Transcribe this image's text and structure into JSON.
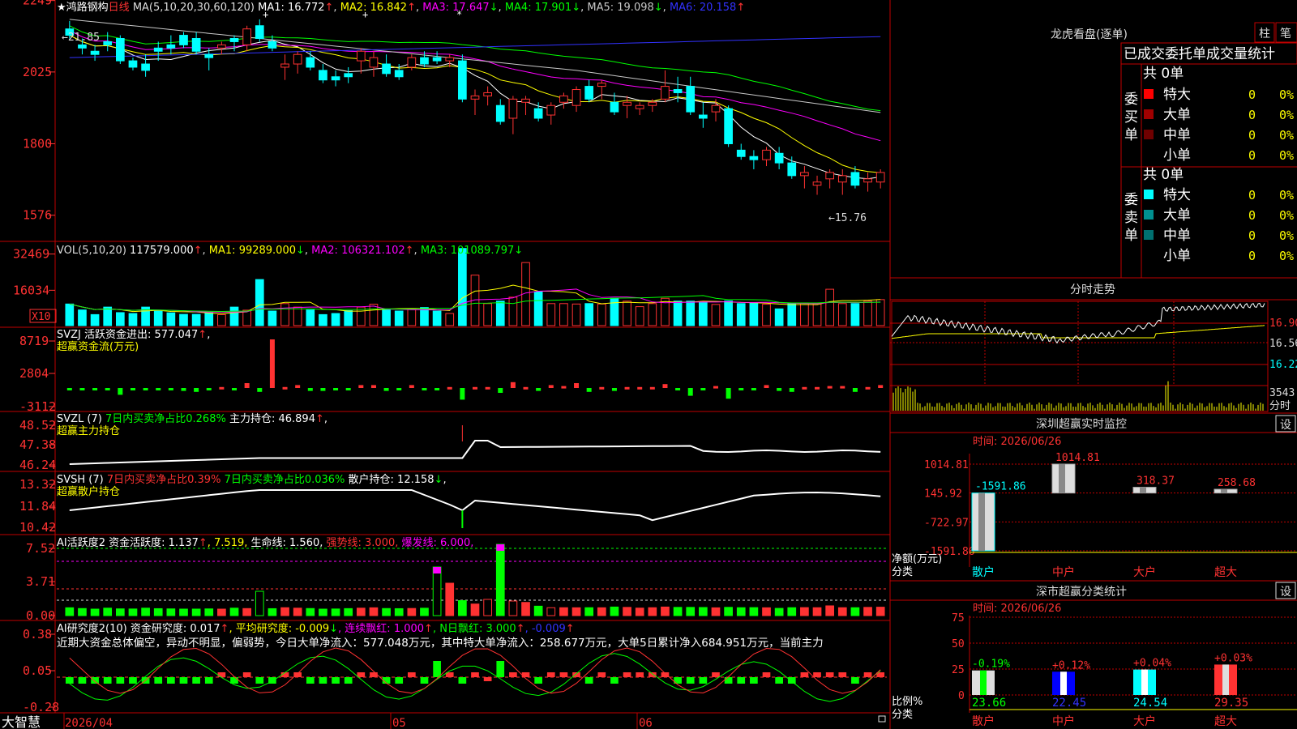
{
  "app_name": "大智慧",
  "colors": {
    "up": "#ff3232",
    "down": "#00ffff",
    "ma1": "#ffffff",
    "ma2": "#ffff00",
    "ma3": "#ff00ff",
    "ma4": "#00ff00",
    "ma5": "#c8c8c8",
    "ma6": "#3232ff",
    "panel_border": "#c00000",
    "axis_text": "#ff3232",
    "green": "#00ff00"
  },
  "kline": {
    "title_star": "★",
    "stock_name": "鸿路钢构",
    "period": "日线",
    "ma_params": "MA(5,10,20,30,60,120)",
    "ma_values": [
      {
        "label": "MA1: 16.772",
        "arrow": "↑",
        "arrow_color": "#ff3232",
        "color": "#ffffff"
      },
      {
        "label": "MA2: 16.842",
        "arrow": "↑",
        "arrow_color": "#ff3232",
        "color": "#ffff00"
      },
      {
        "label": "MA3: 17.647",
        "arrow": "↓",
        "arrow_color": "#00ff00",
        "color": "#ff00ff"
      },
      {
        "label": "MA4: 17.901",
        "arrow": "↓",
        "arrow_color": "#00ff00",
        "color": "#00ff00"
      },
      {
        "label": "MA5: 19.098",
        "arrow": "↓",
        "arrow_color": "#00ff00",
        "color": "#c8c8c8"
      },
      {
        "label": "MA6: 20.158",
        "arrow": "↑",
        "arrow_color": "#ff3232",
        "color": "#3232ff"
      }
    ],
    "y_ticks": [
      "2249",
      "2025",
      "1800",
      "1576"
    ],
    "high_label": "←21.85",
    "low_label": "←15.76"
  },
  "volume": {
    "params": "VOL(5,10,20)",
    "value": "117579.000",
    "value_arrow": "↑",
    "ma": [
      {
        "label": "MA1: 99289.000",
        "arrow": "↓",
        "color": "#ffff00",
        "arrow_color": "#00ff00"
      },
      {
        "label": "MA2: 106321.102",
        "arrow": "↑",
        "color": "#ff00ff",
        "arrow_color": "#ff3232"
      },
      {
        "label": "MA3: 101089.797",
        "arrow": "↓",
        "color": "#00ff00",
        "arrow_color": "#00ff00"
      }
    ],
    "y_ticks": [
      "32469",
      "16034"
    ],
    "unit": "X10"
  },
  "svzj": {
    "line1_prefix": "SVZJ  活跃资金进出: 577.047",
    "line1_arrow": "↑",
    "line1_tail": ",",
    "line2": "超赢资金流(万元)",
    "y_ticks": [
      "8719",
      "2804",
      "-3112"
    ]
  },
  "svzl": {
    "prefix": "SVZL (7)",
    "part1": "7日内买卖净占比0.268%",
    "part2": "主力持仓: 46.894",
    "arrow": "↑",
    "tail": ",",
    "line2": "超赢主力持仓",
    "y_ticks": [
      "48.52",
      "47.38",
      "46.24"
    ]
  },
  "svsh": {
    "prefix": "SVSH (7)",
    "part1": "7日内买卖净占比0.39%",
    "part2": "7日内买卖净占比0.036%",
    "part3": "散户持仓: 12.158",
    "arrow": "↓",
    "tail": ",",
    "line2": "超赢散户持仓",
    "y_ticks": [
      "13.32",
      "11.84",
      "10.42"
    ]
  },
  "ai_active": {
    "title": "AI活跃度2 资金活跃度: 1.137",
    "arrow1": "↑",
    "part2": ", 7.519,",
    "part3": "生命线: 1.560,",
    "part4": "强势线: 3.000,",
    "part5": "爆发线: 6.000,",
    "y_ticks": [
      "7.52",
      "3.71",
      "0.00"
    ]
  },
  "ai_research": {
    "title": "AI研究度2(10) 资金研究度: 0.017",
    "arrow1": "↑",
    "part2": ", 平均研究度: -0.009",
    "arrow2": "↓",
    "part3": ", 连续飘红: 1.000",
    "arrow3": "↑",
    "part4": ", N日飘红: 3.000",
    "arrow4": "↑",
    "part5": ", -0.009",
    "arrow5": "↑",
    "comment": "近期大资金总体偏空，异动不明显，偏弱势，今日大单净流入：577.048万元，其中特大单净流入：258.677万元，大单5日累计净入684.951万元，当前主力",
    "y_ticks": [
      "0.38",
      "0.05",
      "-0.28"
    ]
  },
  "x_axis": {
    "labels": [
      "2026/04",
      "05",
      "06"
    ]
  },
  "longhu": {
    "title": "龙虎看盘(逐单)",
    "btn_zhu": "柱",
    "btn_bi": "笔",
    "tabs_header": "已成交委托单成交量统计",
    "buy_label": "委买单",
    "sell_label": "委卖单",
    "buy_total": "共 0单",
    "sell_total": "共 0单",
    "buy_rows": [
      {
        "name": "特大",
        "vol": "0",
        "pct": "0%",
        "color": "#ff0000"
      },
      {
        "name": "大单",
        "vol": "0",
        "pct": "0%",
        "color": "#a00000"
      },
      {
        "name": "中单",
        "vol": "0",
        "pct": "0%",
        "color": "#700000"
      },
      {
        "name": "小单",
        "vol": "0",
        "pct": "0%",
        "color": ""
      }
    ],
    "sell_rows": [
      {
        "name": "特大",
        "vol": "0",
        "pct": "0%",
        "color": "#00ffff"
      },
      {
        "name": "大单",
        "vol": "0",
        "pct": "0%",
        "color": "#009090"
      },
      {
        "name": "中单",
        "vol": "0",
        "pct": "0%",
        "color": "#007070"
      },
      {
        "name": "小单",
        "vol": "0",
        "pct": "0%",
        "color": ""
      }
    ]
  },
  "intraday": {
    "title": "分时走势",
    "y_ticks": [
      "16.90",
      "16.56",
      "16.22"
    ],
    "vol_tick": "3543",
    "vol_label": "分时"
  },
  "sz_monitor": {
    "title": "深圳超赢实时监控",
    "settings": "设",
    "time_label": "时间: 2026/06/26",
    "y_ticks": [
      "1014.81",
      "145.92",
      "-722.97",
      "-1591.86"
    ],
    "axis_label1": "净额(万元)",
    "axis_label2": "分类",
    "categories": [
      "散户",
      "中户",
      "大户",
      "超大"
    ],
    "values": [
      -1591.86,
      1014.81,
      318.37,
      258.68
    ],
    "value_labels": [
      "-1591.86",
      "1014.81",
      "318.37",
      "258.68"
    ]
  },
  "sz_class": {
    "title": "深市超赢分类统计",
    "settings": "设",
    "time_label": "时间: 2026/06/26",
    "y_ticks": [
      "75",
      "50",
      "25",
      "0"
    ],
    "axis_label1": "比例%",
    "axis_label2": "分类",
    "categories": [
      "散户",
      "中户",
      "大户",
      "超大"
    ],
    "values": [
      23.66,
      22.45,
      24.54,
      29.35
    ],
    "value_labels": [
      "23.66",
      "22.45",
      "24.54",
      "29.35"
    ],
    "change_labels": [
      "-0.19%",
      "+0.12%",
      "+0.04%",
      "+0.03%"
    ]
  },
  "chart_data": {
    "type": "candlestick",
    "title": "鸿路钢构 日线",
    "y_range": [
      15.76,
      21.85
    ],
    "x_labels": [
      "2026/04",
      "05",
      "06"
    ],
    "ohlc": [
      [
        21.6,
        21.85,
        21.3,
        21.4
      ],
      [
        21.1,
        21.3,
        20.8,
        21.0
      ],
      [
        20.9,
        21.1,
        20.6,
        20.8
      ],
      [
        21.2,
        21.5,
        20.9,
        21.1
      ],
      [
        21.3,
        21.4,
        20.5,
        20.6
      ],
      [
        20.6,
        20.7,
        20.3,
        20.4
      ],
      [
        20.5,
        20.8,
        20.1,
        20.3
      ],
      [
        21.0,
        21.2,
        20.6,
        20.9
      ],
      [
        21.1,
        21.4,
        20.8,
        21.0
      ],
      [
        21.4,
        21.5,
        21.0,
        21.1
      ],
      [
        21.3,
        21.5,
        20.8,
        20.9
      ],
      [
        20.8,
        21.0,
        20.3,
        20.7
      ],
      [
        21.0,
        21.2,
        20.8,
        21.1
      ],
      [
        21.3,
        21.4,
        20.9,
        21.2
      ],
      [
        21.1,
        21.7,
        20.9,
        21.6
      ],
      [
        21.7,
        21.9,
        21.2,
        21.3
      ],
      [
        21.2,
        21.4,
        20.9,
        21.0
      ],
      [
        20.4,
        20.8,
        20.0,
        20.5
      ],
      [
        20.5,
        20.9,
        20.2,
        20.8
      ],
      [
        20.7,
        20.9,
        20.3,
        20.4
      ],
      [
        20.3,
        20.5,
        19.9,
        20.0
      ],
      [
        20.1,
        20.3,
        19.8,
        20.0
      ],
      [
        20.2,
        20.4,
        19.9,
        20.1
      ],
      [
        20.6,
        21.0,
        20.2,
        20.9
      ],
      [
        20.4,
        20.9,
        20.1,
        20.7
      ],
      [
        20.5,
        20.8,
        20.1,
        20.2
      ],
      [
        20.3,
        20.5,
        20.0,
        20.1
      ],
      [
        20.4,
        20.8,
        20.3,
        20.7
      ],
      [
        20.7,
        20.9,
        20.4,
        20.5
      ],
      [
        20.7,
        20.9,
        20.5,
        20.6
      ],
      [
        20.6,
        20.8,
        20.4,
        20.7
      ],
      [
        20.6,
        20.8,
        19.3,
        19.4
      ],
      [
        19.4,
        19.7,
        18.9,
        19.5
      ],
      [
        19.5,
        19.8,
        19.2,
        19.6
      ],
      [
        19.2,
        19.4,
        18.6,
        18.7
      ],
      [
        18.8,
        19.5,
        18.3,
        19.4
      ],
      [
        19.3,
        19.5,
        18.9,
        19.4
      ],
      [
        19.1,
        19.3,
        18.7,
        18.8
      ],
      [
        18.9,
        19.3,
        18.6,
        19.2
      ],
      [
        19.3,
        19.6,
        19.1,
        19.5
      ],
      [
        19.2,
        19.8,
        19.0,
        19.7
      ],
      [
        19.8,
        20.0,
        19.3,
        19.4
      ],
      [
        19.8,
        20.0,
        19.4,
        19.9
      ],
      [
        19.3,
        19.6,
        18.9,
        19.0
      ],
      [
        19.2,
        19.5,
        18.8,
        19.3
      ],
      [
        19.1,
        19.3,
        18.9,
        19.2
      ],
      [
        19.2,
        19.4,
        19.0,
        19.3
      ],
      [
        19.4,
        20.3,
        19.3,
        19.8
      ],
      [
        19.7,
        20.1,
        19.3,
        19.6
      ],
      [
        19.8,
        20.1,
        18.9,
        19.0
      ],
      [
        18.9,
        19.3,
        18.5,
        18.8
      ],
      [
        19.0,
        19.4,
        18.7,
        19.2
      ],
      [
        19.1,
        19.2,
        17.9,
        18.0
      ],
      [
        17.8,
        18.0,
        17.5,
        17.6
      ],
      [
        17.6,
        17.8,
        17.2,
        17.5
      ],
      [
        17.5,
        17.9,
        17.3,
        17.8
      ],
      [
        17.7,
        17.9,
        17.2,
        17.4
      ],
      [
        17.4,
        17.6,
        16.9,
        17.0
      ],
      [
        17.0,
        17.3,
        16.6,
        17.1
      ],
      [
        16.7,
        17.0,
        16.4,
        16.8
      ],
      [
        16.9,
        17.2,
        16.6,
        17.1
      ],
      [
        16.8,
        17.2,
        16.4,
        17.0
      ],
      [
        17.1,
        17.3,
        16.6,
        16.7
      ],
      [
        16.8,
        17.1,
        16.5,
        16.9
      ],
      [
        16.8,
        17.2,
        16.6,
        17.1
      ]
    ],
    "volume": [
      9.8,
      7.1,
      5.0,
      8.4,
      5.9,
      5.5,
      8.4,
      6.6,
      5.8,
      5.1,
      5.1,
      5.8,
      5.0,
      8.4,
      7.0,
      20.9,
      6.6,
      10.0,
      8.4,
      7.1,
      5.0,
      5.5,
      6.8,
      8.4,
      9.7,
      7.1,
      6.6,
      7.3,
      8.2,
      6.6,
      5.5,
      35.0,
      22.9,
      10.0,
      11.1,
      12.9,
      28.6,
      15.4,
      10.0,
      10.0,
      9.8,
      10.0,
      9.8,
      12.4,
      11.1,
      8.6,
      10.0,
      12.4,
      11.1,
      11.1,
      10.7,
      9.6,
      11.2,
      10.0,
      10.3,
      9.7,
      7.6,
      10.0,
      10.3,
      10.0,
      16.5,
      10.0,
      10.0,
      11.1,
      11.8
    ]
  }
}
